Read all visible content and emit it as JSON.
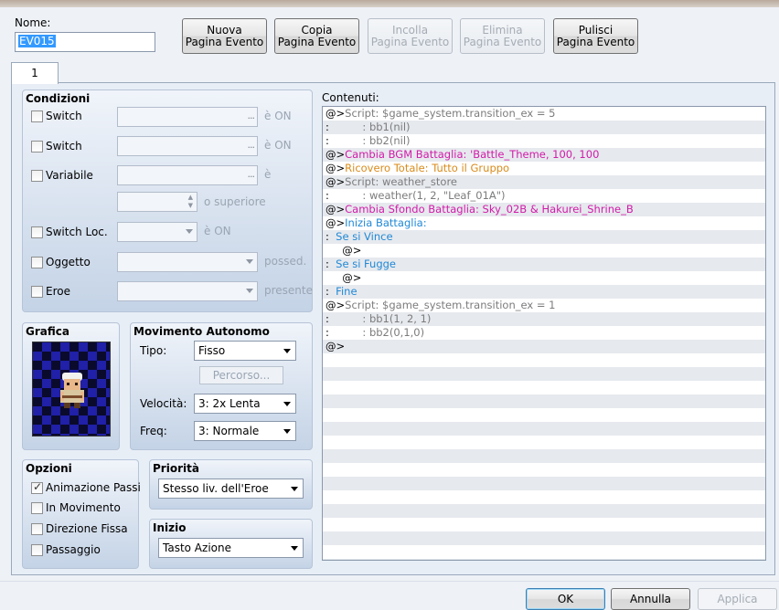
{
  "header": {
    "name_label": "Nome:",
    "name_value": "EV015",
    "buttons": [
      {
        "l1": "Nuova",
        "l2": "Pagina Evento"
      },
      {
        "l1": "Copia",
        "l2": "Pagina Evento"
      },
      {
        "l1": "Incolla",
        "l2": "Pagina Evento"
      },
      {
        "l1": "Elimina",
        "l2": "Pagina Evento"
      },
      {
        "l1": "Pulisci",
        "l2": "Pagina Evento"
      }
    ]
  },
  "tab": "1",
  "conditions": {
    "title": "Condizioni",
    "switch1": "Switch",
    "switch1_suffix": "è ON",
    "switch2": "Switch",
    "switch2_suffix": "è ON",
    "variable": "Variabile",
    "variable_suffix": "è",
    "or_greater": "o superiore",
    "self_switch": "Switch Loc.",
    "self_switch_suffix": "è ON",
    "item": "Oggetto",
    "item_suffix": "possed.",
    "actor": "Eroe",
    "actor_suffix": "presente",
    "dots": "..."
  },
  "graphic": {
    "title": "Grafica"
  },
  "movement": {
    "title": "Movimento Autonomo",
    "type_label": "Tipo:",
    "type_value": "Fisso",
    "route_button": "Percorso...",
    "speed_label": "Velocità:",
    "speed_value": "3: 2x Lenta",
    "freq_label": "Freq:",
    "freq_value": "3: Normale"
  },
  "options": {
    "title": "Opzioni",
    "walk_anim": "Animazione Passi",
    "step_anim": "In Movimento",
    "direction_fix": "Direzione Fissa",
    "through": "Passaggio"
  },
  "priority": {
    "title": "Priorità",
    "value": "Stesso liv. dell'Eroe"
  },
  "trigger": {
    "title": "Inizio",
    "value": "Tasto Azione"
  },
  "contents": {
    "label": "Contenuti:",
    "lines": [
      {
        "pre": "@>",
        "text": "Script: $game_system.transition_ex = 5",
        "color": "gray"
      },
      {
        "pre": " :",
        "text": "          : bb1(nil)",
        "color": "gray"
      },
      {
        "pre": " :",
        "text": "          : bb2(nil)",
        "color": "gray"
      },
      {
        "pre": "@>",
        "text": "Cambia BGM Battaglia: 'Battle_Theme, 100, 100",
        "color": "magenta"
      },
      {
        "pre": "@>",
        "text": "Ricovero Totale: Tutto il Gruppo",
        "color": "orange"
      },
      {
        "pre": "@>",
        "text": "Script: weather_store",
        "color": "gray"
      },
      {
        "pre": " :",
        "text": "          : weather(1, 2, \"Leaf_01A\")",
        "color": "gray"
      },
      {
        "pre": "@>",
        "text": "Cambia Sfondo Battaglia: Sky_02B & Hakurei_Shrine_B",
        "color": "magenta"
      },
      {
        "pre": "@>",
        "text": "Inizia Battaglia:",
        "color": "blue"
      },
      {
        "pre": " :",
        "text": "  Se si Vince",
        "color": "blue"
      },
      {
        "pre": "",
        "text": "     @>",
        "color": "black"
      },
      {
        "pre": " :",
        "text": "  Se si Fugge",
        "color": "blue"
      },
      {
        "pre": "",
        "text": "     @>",
        "color": "black"
      },
      {
        "pre": " :",
        "text": "  Fine",
        "color": "blue"
      },
      {
        "pre": "@>",
        "text": "Script: $game_system.transition_ex = 1",
        "color": "gray"
      },
      {
        "pre": " :",
        "text": "          : bb1(1, 2, 1)",
        "color": "gray"
      },
      {
        "pre": " :",
        "text": "          : bb2(0,1,0)",
        "color": "gray"
      },
      {
        "pre": "@>",
        "text": "",
        "color": "black"
      }
    ]
  },
  "footer": {
    "ok": "OK",
    "cancel": "Annulla",
    "apply": "Applica"
  },
  "colors": {
    "gray": "#7c7c7c",
    "magenta": "#d21ba9",
    "orange": "#d98b1b",
    "blue": "#2189d6",
    "black": "#000000"
  }
}
